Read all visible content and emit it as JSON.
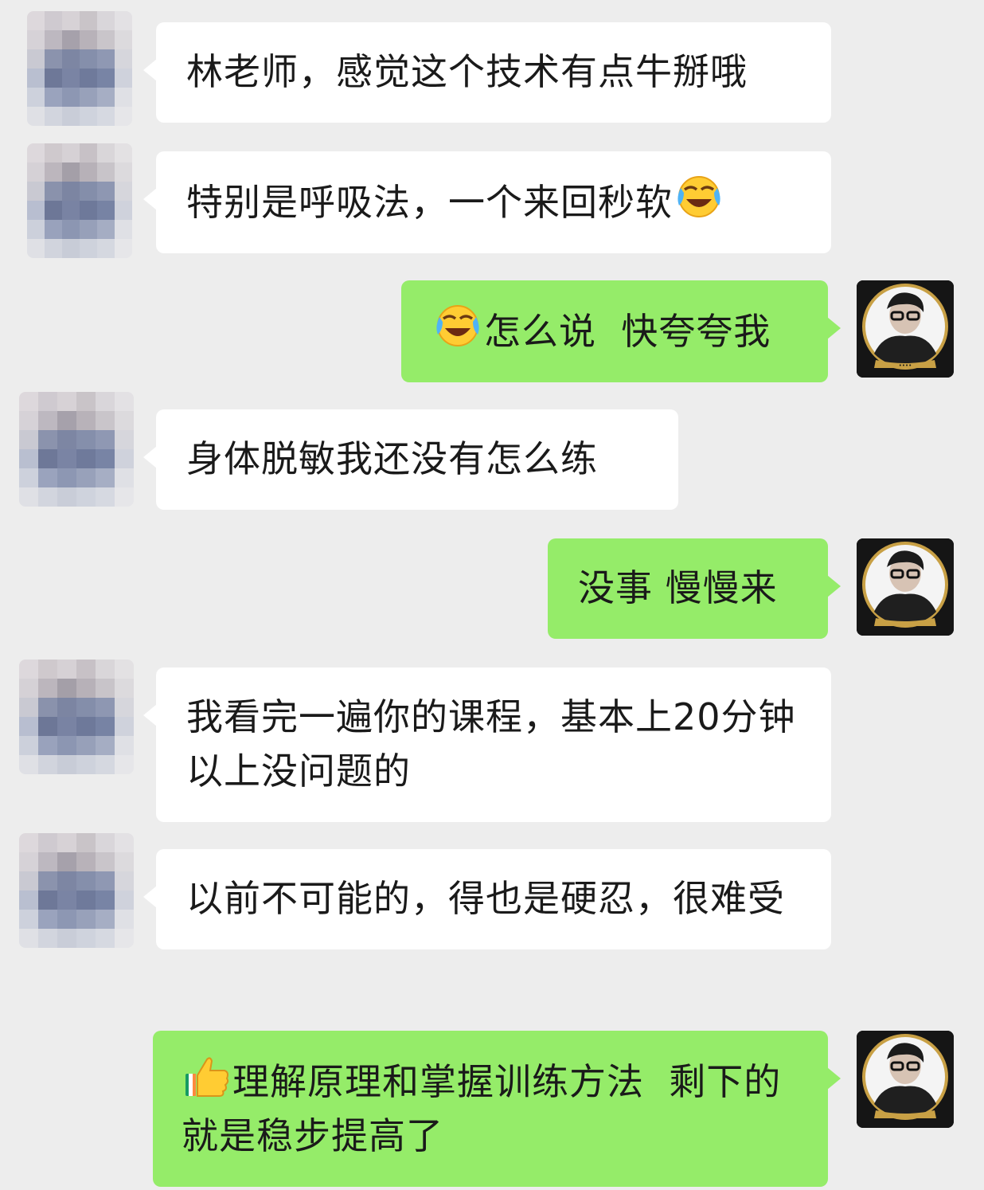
{
  "messages": [
    {
      "side": "in",
      "text": "林老师，感觉这个技术有点牛掰哦"
    },
    {
      "side": "in",
      "text": "特别是呼吸法，一个来回秒软",
      "emoji": "face-with-tears-of-joy"
    },
    {
      "side": "out",
      "emoji": "face-with-tears-of-joy",
      "text": "怎么说  快夸夸我"
    },
    {
      "side": "in",
      "text": "身体脱敏我还没有怎么练"
    },
    {
      "side": "out",
      "text": "没事 慢慢来"
    },
    {
      "side": "in",
      "text": "我看完一遍你的课程，基本上20分钟以上没问题的"
    },
    {
      "side": "in",
      "text": "以前不可能的，得也是硬忍，很难受"
    },
    {
      "side": "out",
      "emoji": "thumbs-up",
      "text": "理解原理和掌握训练方法  剩下的就是稳步提高了"
    }
  ],
  "colors": {
    "background": "#ededed",
    "incoming_bubble": "#ffffff",
    "outgoing_bubble": "#95ec69",
    "text": "#1a1a1a"
  }
}
